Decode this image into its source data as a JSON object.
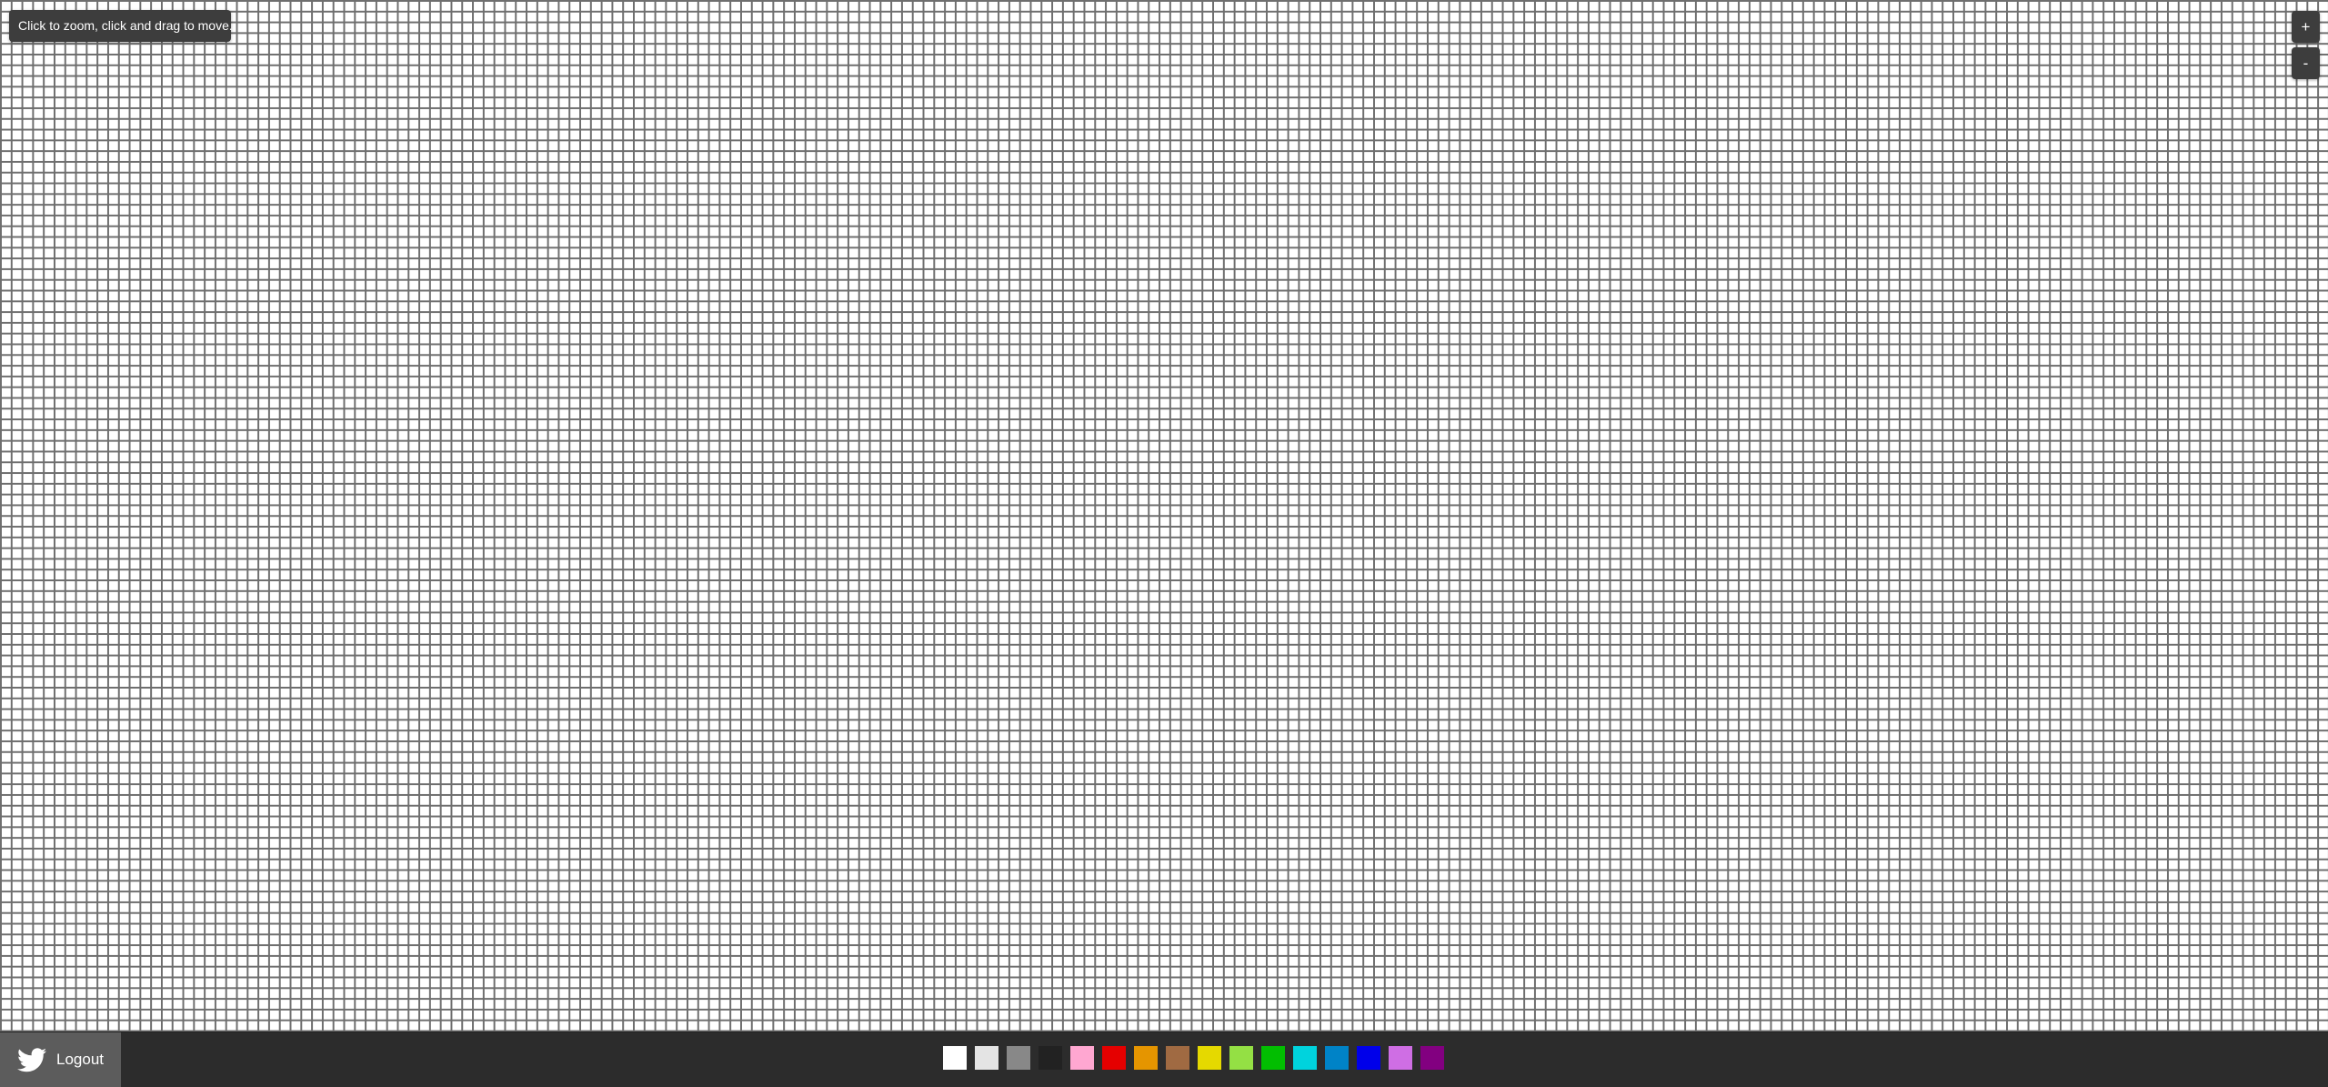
{
  "canvas": {
    "hint_text": "Click to zoom, click and drag to move.",
    "grid_line_color": "#6e6e6e",
    "background_color": "#ffffff"
  },
  "zoom": {
    "in_label": "+",
    "out_label": "-"
  },
  "footer": {
    "logout_label": "Logout",
    "logout_icon": "twitter-bird-icon",
    "palette": [
      {
        "name": "white",
        "color": "#ffffff"
      },
      {
        "name": "light-gray",
        "color": "#e4e4e4"
      },
      {
        "name": "gray",
        "color": "#888888"
      },
      {
        "name": "black",
        "color": "#222222"
      },
      {
        "name": "pink",
        "color": "#ffa7d1"
      },
      {
        "name": "red",
        "color": "#e50000"
      },
      {
        "name": "orange",
        "color": "#e59500"
      },
      {
        "name": "brown",
        "color": "#a06a42"
      },
      {
        "name": "yellow",
        "color": "#e5d900"
      },
      {
        "name": "light-green",
        "color": "#94e044"
      },
      {
        "name": "green",
        "color": "#02be01"
      },
      {
        "name": "cyan",
        "color": "#00d3dd"
      },
      {
        "name": "blue",
        "color": "#0083c7"
      },
      {
        "name": "dark-blue",
        "color": "#0000ea"
      },
      {
        "name": "magenta",
        "color": "#cf6ee4"
      },
      {
        "name": "purple",
        "color": "#820080"
      }
    ]
  }
}
